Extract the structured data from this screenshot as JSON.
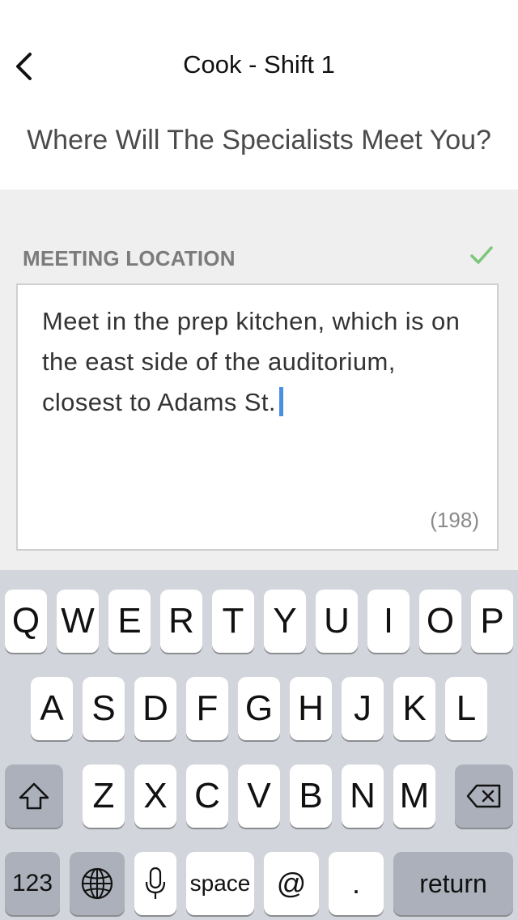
{
  "nav": {
    "title": "Cook - Shift 1"
  },
  "subtitle": "Where Will The Specialists Meet You?",
  "field": {
    "label": "MEETING LOCATION",
    "value": "Meet in the prep kitchen, which is on the east side of the auditorium, closest to Adams St.",
    "char_count": "(198)",
    "status_color": "#7ac77a",
    "caret_color": "#4a90e2"
  },
  "keyboard": {
    "row1": [
      "Q",
      "W",
      "E",
      "R",
      "T",
      "Y",
      "U",
      "I",
      "O",
      "P"
    ],
    "row2": [
      "A",
      "S",
      "D",
      "F",
      "G",
      "H",
      "J",
      "K",
      "L"
    ],
    "row3": [
      "Z",
      "X",
      "C",
      "V",
      "B",
      "N",
      "M"
    ],
    "numbers_label": "123",
    "space_label": "space",
    "at_label": "@",
    "period_label": ".",
    "return_label": "return"
  }
}
